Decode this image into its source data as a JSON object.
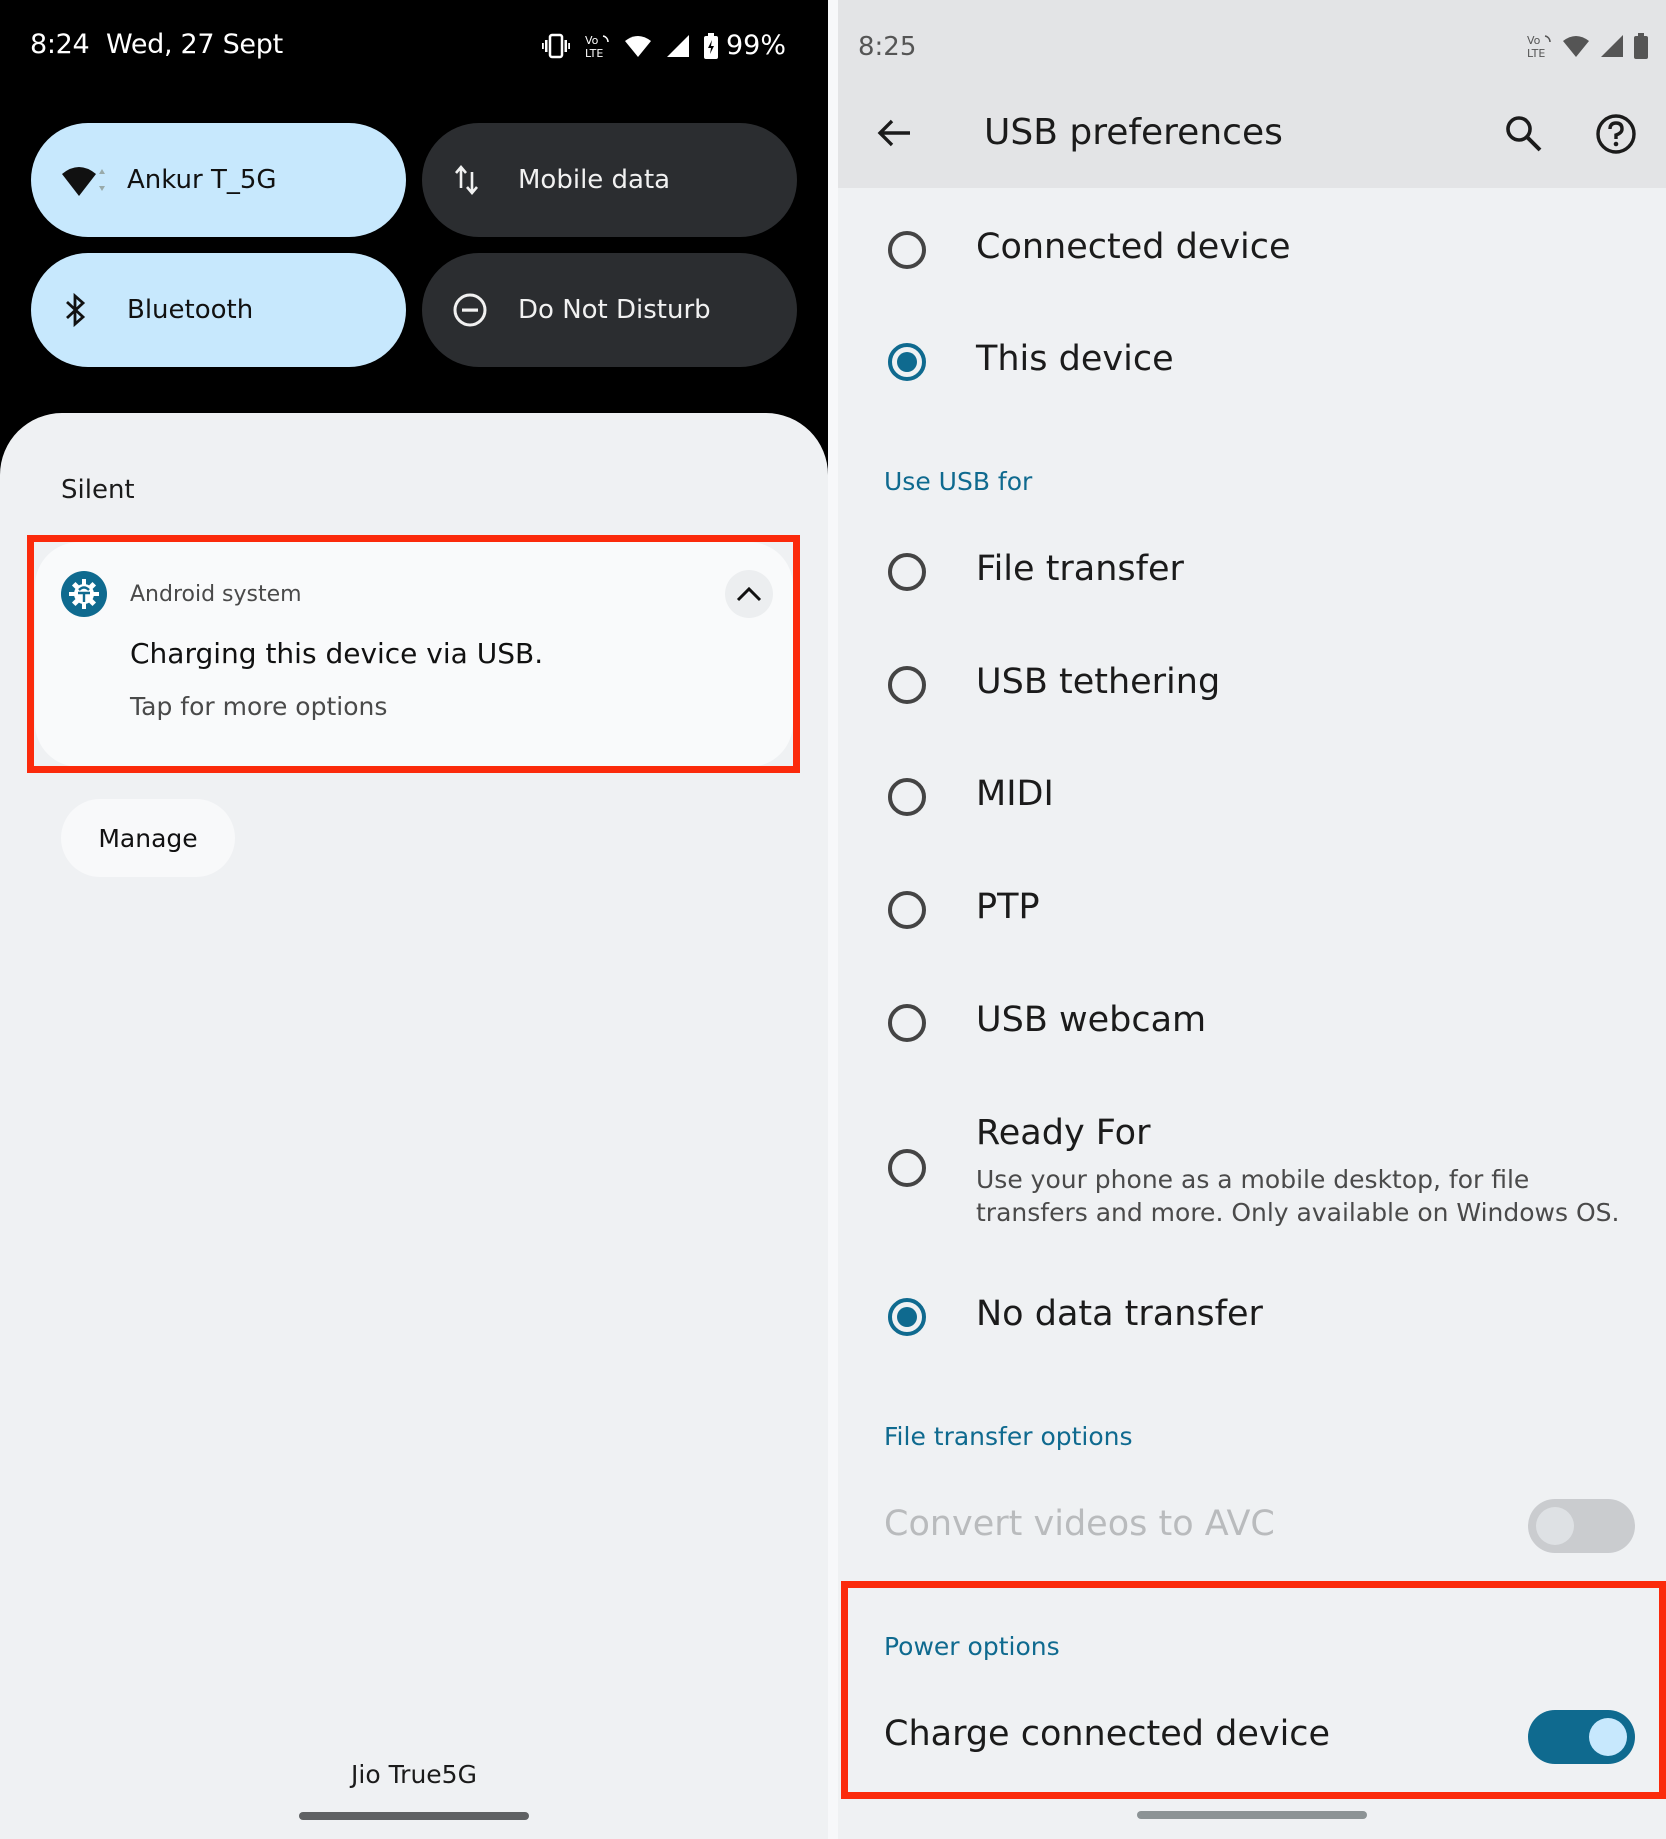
{
  "left_panel": {
    "status_bar": {
      "time": "8:24",
      "date": "Wed, 27 Sept",
      "icons": [
        "vibrate-icon",
        "volte-icon",
        "wifi-icon",
        "signal-icon",
        "battery-charging-icon"
      ],
      "battery_percent": "99%"
    },
    "quick_tiles": [
      {
        "label": "Ankur T_5G",
        "icon": "wifi-icon",
        "state": "on"
      },
      {
        "label": "Mobile data",
        "icon": "mobile-data-icon",
        "state": "off"
      },
      {
        "label": "Bluetooth",
        "icon": "bluetooth-icon",
        "state": "on"
      },
      {
        "label": "Do Not Disturb",
        "icon": "do-not-disturb-icon",
        "state": "off"
      }
    ],
    "section_label": "Silent",
    "notification": {
      "app_name": "Android system",
      "app_icon": "android-system-gear-icon",
      "title": "Charging this device via USB.",
      "subtitle": "Tap for more options",
      "expand_icon": "chevron-up-icon",
      "highlighted": true
    },
    "manage_label": "Manage",
    "carrier": "Jio True5G"
  },
  "right_panel": {
    "status_bar": {
      "time": "8:25",
      "icons": [
        "volte-icon",
        "wifi-icon",
        "signal-icon",
        "battery-icon"
      ]
    },
    "header": {
      "title": "USB preferences",
      "back_icon": "arrow-back-icon",
      "search_icon": "search-icon",
      "help_icon": "help-icon"
    },
    "usb_controlled_by": [
      {
        "label": "Connected device",
        "selected": false
      },
      {
        "label": "This device",
        "selected": true
      }
    ],
    "use_usb_for": {
      "heading": "Use USB for",
      "options": [
        {
          "label": "File transfer",
          "selected": false
        },
        {
          "label": "USB tethering",
          "selected": false
        },
        {
          "label": "MIDI",
          "selected": false
        },
        {
          "label": "PTP",
          "selected": false
        },
        {
          "label": "USB webcam",
          "selected": false
        },
        {
          "label": "Ready For",
          "description_line1": "Use your phone as a mobile desktop, for file",
          "description_line2": "transfers and more. Only available on Windows OS.",
          "selected": false
        },
        {
          "label": "No data transfer",
          "selected": true
        }
      ]
    },
    "file_transfer_options": {
      "heading": "File transfer options",
      "convert_videos": {
        "label": "Convert videos to AVC",
        "enabled": false,
        "checked": false
      }
    },
    "power_options": {
      "heading": "Power options",
      "charge_connected_device": {
        "label": "Charge connected device",
        "checked": true
      },
      "highlighted": true
    }
  },
  "colors": {
    "accent": "#0f6a8f",
    "tile_on": "#c7e8fd",
    "tile_off": "#2b2d30",
    "highlight_box": "#fb2a0b",
    "sheet_bg": "#eff1f3"
  }
}
